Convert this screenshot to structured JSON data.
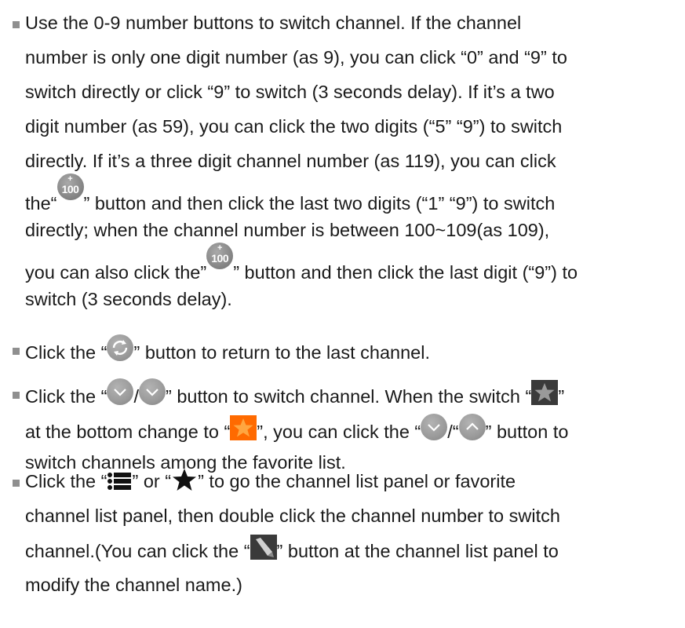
{
  "items": [
    {
      "lines": [
        [
          {
            "t": "Use the 0-9 number buttons to switch channel. If the channel"
          }
        ],
        [
          {
            "t": "number is only one digit number (as 9), you can click “0” and “9” to"
          }
        ],
        [
          {
            "t": "switch directly or click “9” to switch (3 seconds delay). If it’s a two"
          }
        ],
        [
          {
            "t": "digit number (as 59), you can click the two digits (“5” “9”) to switch"
          }
        ],
        [
          {
            "t": "directly. If it’s a three digit channel number (as 119), you can click"
          }
        ],
        [
          {
            "t": "the“"
          },
          {
            "i": "hundred-plus-icon"
          },
          {
            "t": "” button and then click the last two digits (“1” “9”) to switch"
          }
        ],
        [
          {
            "t": "directly; when the channel number is between 100~109(as 109),"
          }
        ],
        [
          {
            "t": "you can also click the”"
          },
          {
            "i": "hundred-plus-icon"
          },
          {
            "t": "” button and then click the last digit (“9”) to"
          }
        ],
        [
          {
            "t": "switch (3 seconds delay)."
          }
        ]
      ]
    },
    {
      "lines": [
        [
          {
            "t": "Click the “"
          },
          {
            "i": "recall-icon"
          },
          {
            "t": "” button to return to the last channel."
          }
        ]
      ]
    },
    {
      "lines": [
        [
          {
            "t": "Click the “"
          },
          {
            "i": "chevron-down-icon"
          },
          {
            "t": "/"
          },
          {
            "i": "chevron-down-icon"
          },
          {
            "t": "” button to switch channel. When the switch “"
          },
          {
            "i": "star-off-icon"
          },
          {
            "t": "”"
          }
        ],
        [
          {
            "t": "at the bottom change to “"
          },
          {
            "i": "star-on-icon"
          },
          {
            "t": "”, you can click the “"
          },
          {
            "i": "chevron-down-icon"
          },
          {
            "t": "/“"
          },
          {
            "i": "chevron-up-icon"
          },
          {
            "t": "” button to"
          }
        ],
        [
          {
            "t": "switch channels among the favorite list."
          }
        ]
      ]
    },
    {
      "lines": [
        [
          {
            "t": "Click the “"
          },
          {
            "i": "list-icon"
          },
          {
            "t": "” or “"
          },
          {
            "i": "star-icon"
          },
          {
            "t": "” to go the channel list panel or favorite"
          }
        ],
        [
          {
            "t": "channel list panel, then double click the channel number to switch"
          }
        ],
        [
          {
            "t": "channel.(You can click the “"
          },
          {
            "i": "edit-icon"
          },
          {
            "t": "” button at the channel list panel to"
          }
        ],
        [
          {
            "t": "modify the channel name.)"
          }
        ]
      ]
    }
  ],
  "icon_text": {
    "plus": "+",
    "num": "100"
  },
  "colors": {
    "text": "#1a1a1a",
    "bullet": "#8f8f8f",
    "icon_gray": "#9a9a9a",
    "star_on": "#ff6a00",
    "star_off_bg": "#3a3a3a"
  }
}
